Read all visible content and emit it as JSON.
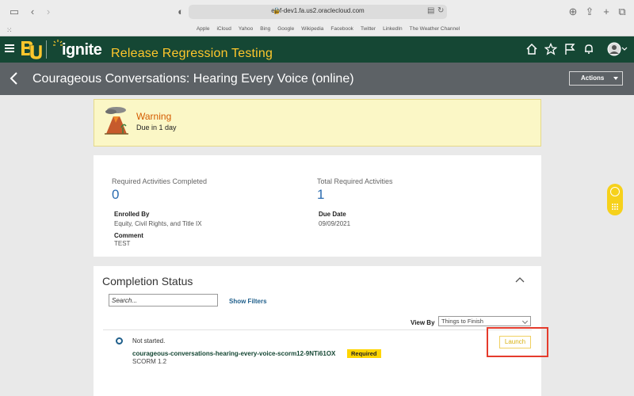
{
  "browser": {
    "url": "ejof-dev1.fa.us2.oraclecloud.com",
    "favorites": [
      "Apple",
      "iCloud",
      "Yahoo",
      "Bing",
      "Google",
      "Wikipedia",
      "Facebook",
      "Twitter",
      "LinkedIn",
      "The Weather Channel"
    ]
  },
  "header": {
    "logo_text": "ignite",
    "app_title": "Release Regression Testing",
    "brand_color": "#154734",
    "accent_color": "#ffc72c"
  },
  "page": {
    "title": "Courageous Conversations: Hearing Every Voice (online)",
    "actions_label": "Actions"
  },
  "warning": {
    "title": "Warning",
    "subtitle": "Due in 1 day"
  },
  "summary": {
    "completed_label": "Required Activities Completed",
    "completed_value": "0",
    "total_label": "Total Required Activities",
    "total_value": "1",
    "enrolled_by_label": "Enrolled By",
    "enrolled_by_value": "Equity, Civil Rights, and Title IX",
    "due_date_label": "Due Date",
    "due_date_value": "09/09/2021",
    "comment_label": "Comment",
    "comment_value": "TEST"
  },
  "completion": {
    "title": "Completion Status",
    "search_placeholder": "Search...",
    "show_filters": "Show Filters",
    "view_by_label": "View By",
    "view_by_value": "Things to Finish",
    "activity": {
      "status": "Not started.",
      "name": "courageous-conversations-hearing-every-voice-scorm12-9NTi61OX",
      "badge": "Required",
      "type": "SCORM 1.2",
      "launch_label": "Launch"
    }
  }
}
